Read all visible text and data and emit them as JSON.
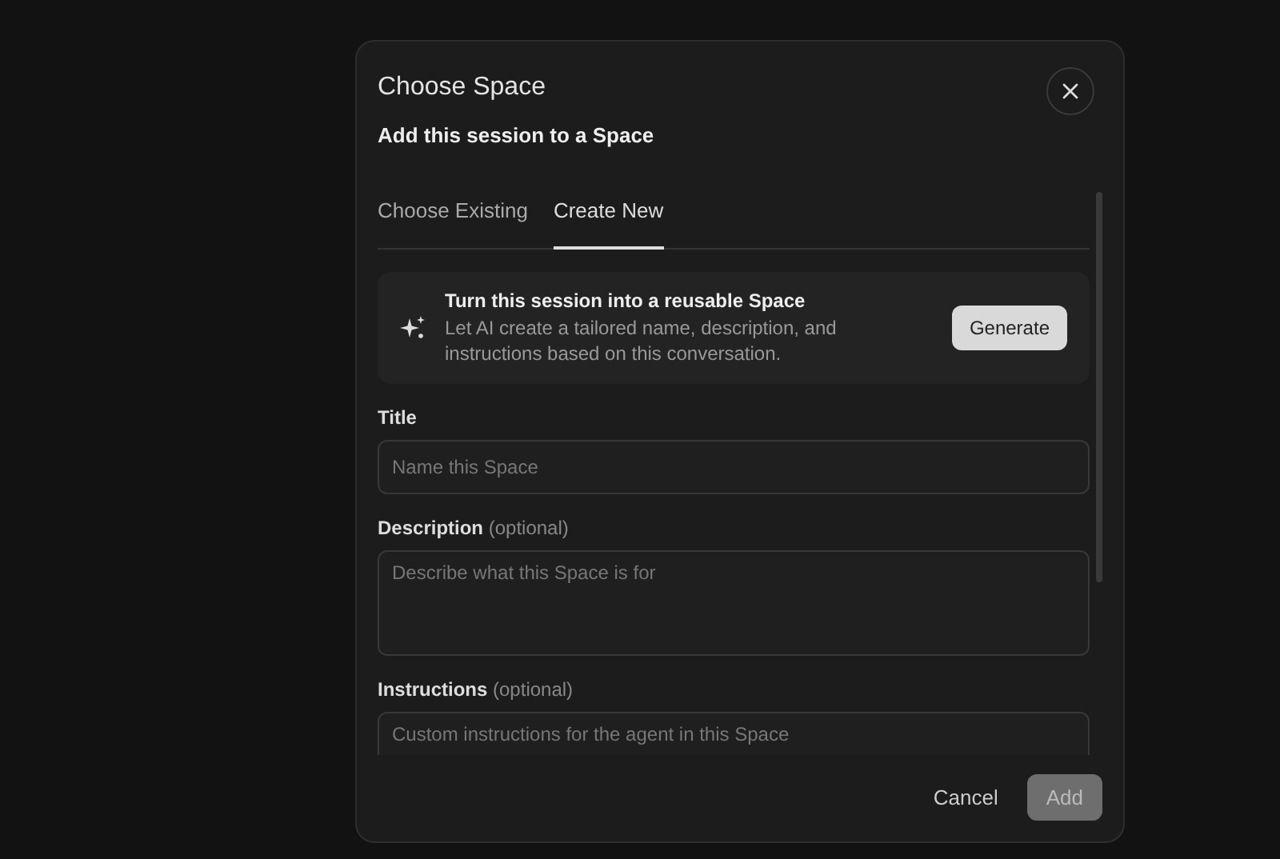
{
  "dialog": {
    "title": "Choose Space",
    "subtitle": "Add this session to a Space"
  },
  "tabs": [
    {
      "label": "Choose Existing",
      "selected": false
    },
    {
      "label": "Create New",
      "selected": true
    }
  ],
  "generate_card": {
    "title": "Turn this session into a reusable Space",
    "description": "Let AI create a tailored name, description, and instructions based on this conversation.",
    "button": "Generate"
  },
  "fields": [
    {
      "kind": "input",
      "label": "Title",
      "placeholder": "Name this Space"
    },
    {
      "kind": "textarea",
      "label": "Description",
      "optional": "(optional)",
      "placeholder": "Describe what this Space is for"
    },
    {
      "kind": "textarea",
      "label": "Instructions",
      "optional": "(optional)",
      "placeholder": "Custom instructions for the agent in this Space"
    }
  ],
  "footer": {
    "cancel": "Cancel",
    "add": {
      "label": "Add",
      "disabled": true
    }
  }
}
